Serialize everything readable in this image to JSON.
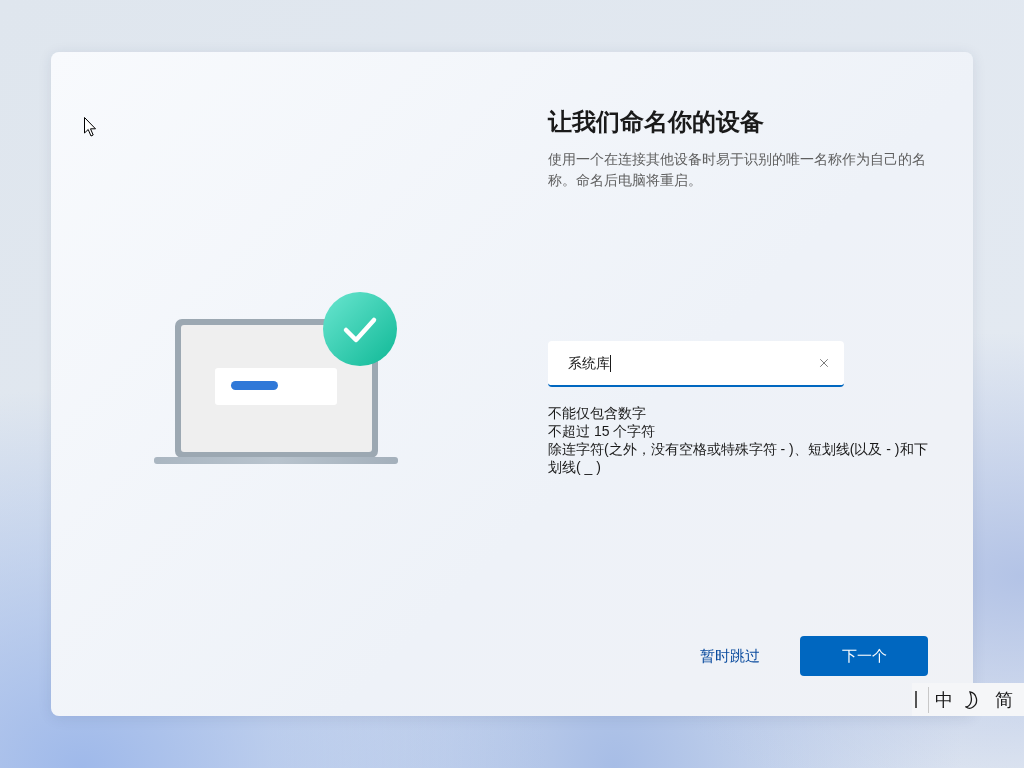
{
  "page": {
    "title": "让我们命名你的设备",
    "description": "使用一个在连接其他设备时易于识别的唯一名称作为自己的名称。命名后电脑将重启。"
  },
  "name_field": {
    "value": "系统库",
    "focused": true
  },
  "requirements": [
    "不能仅包含数字",
    "不超过 15 个字符",
    "除连字符(之外，没有空格或特殊字符 - )、短划线(以及 - )和下划线( _ )"
  ],
  "actions": {
    "skip": "暂时跳过",
    "next": "下一个"
  },
  "ime_bar": {
    "language": "中",
    "charset": "简"
  }
}
